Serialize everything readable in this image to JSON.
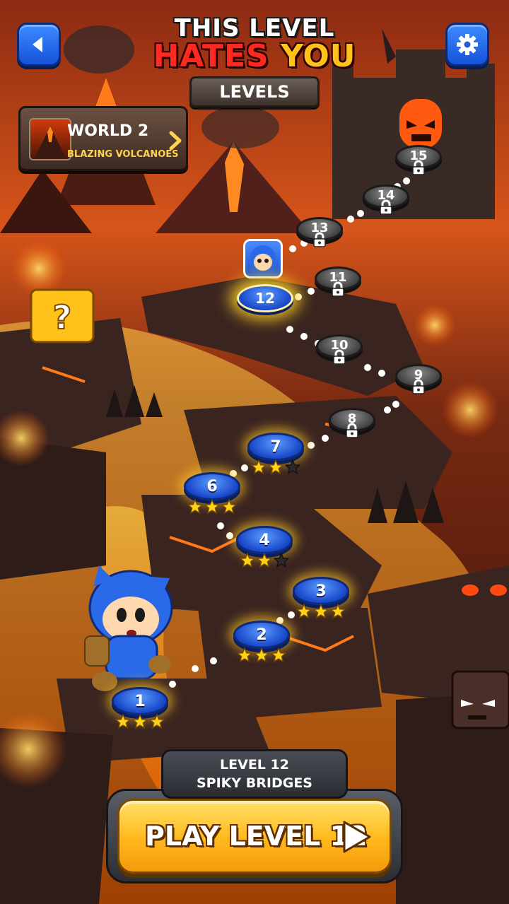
{
  "header": {
    "title_line1": "THIS LEVEL",
    "title_hates": "HATES",
    "title_you": "YOU",
    "subtitle": "LEVELS",
    "back_icon": "back-arrow-icon",
    "settings_icon": "gear-icon"
  },
  "world": {
    "name": "WORLD 2",
    "subtitle": "BLAZING VOLCANOES",
    "chevron_icon": "chevron-right-icon"
  },
  "levels": [
    {
      "number": "1",
      "state": "unlocked",
      "stars": 3
    },
    {
      "number": "2",
      "state": "unlocked",
      "stars": 3
    },
    {
      "number": "3",
      "state": "unlocked",
      "stars": 3
    },
    {
      "number": "4",
      "state": "unlocked",
      "stars": 2
    },
    {
      "number": "6",
      "state": "unlocked",
      "stars": 3
    },
    {
      "number": "7",
      "state": "unlocked",
      "stars": 2
    },
    {
      "number": "12",
      "state": "current",
      "stars": 0
    },
    {
      "number": "8",
      "state": "locked",
      "stars": 0
    },
    {
      "number": "9",
      "state": "locked",
      "stars": 0
    },
    {
      "number": "10",
      "state": "locked",
      "stars": 0
    },
    {
      "number": "11",
      "state": "locked",
      "stars": 0
    },
    {
      "number": "13",
      "state": "locked",
      "stars": 0
    },
    {
      "number": "14",
      "state": "locked",
      "stars": 0
    },
    {
      "number": "15",
      "state": "locked",
      "stars": 0
    }
  ],
  "selected": {
    "line1": "LEVEL 12",
    "line2": "SPIKY BRIDGES"
  },
  "play_button": {
    "label": "PLAY LEVEL 12",
    "icon": "play-triangle-icon"
  },
  "colors": {
    "lava": "#ff7a10",
    "rock": "#3a2420",
    "level_blue": "#1f5bd8",
    "locked_grey": "#555555",
    "star_gold": "#ffd21a",
    "play_yellow": "#ffc21a"
  }
}
